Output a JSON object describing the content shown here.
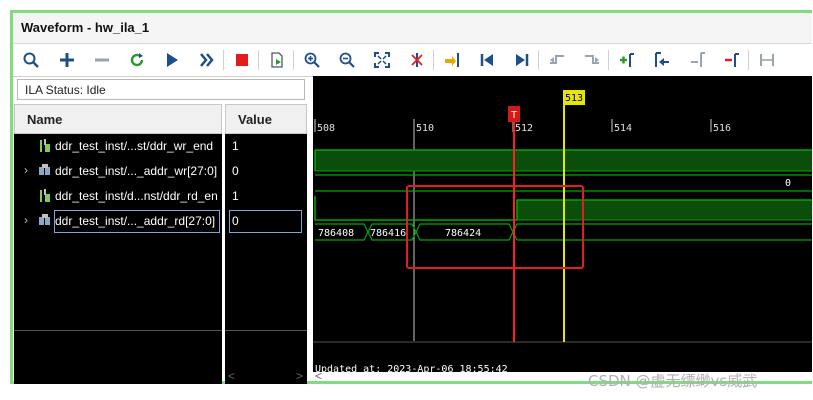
{
  "window": {
    "title": "Waveform - hw_ila_1"
  },
  "toolbar": {
    "icons": [
      "search-icon",
      "plus-icon",
      "minus-icon",
      "refresh-icon",
      "play-icon",
      "fast-forward-icon",
      "stop-icon",
      "export-icon",
      "zoom-in-icon",
      "zoom-out-icon",
      "zoom-fit-icon",
      "cursor-icon",
      "go-to-cursor-icon",
      "first-marker-icon",
      "last-marker-icon",
      "add-marker-icon",
      "remove-marker-icon",
      "prev-transition-icon",
      "next-transition-icon",
      "add-marker-icon",
      "prev-marker-icon",
      "next-marker-icon",
      "swap-cursor-icon"
    ]
  },
  "status": {
    "text": "ILA Status: Idle"
  },
  "columns": {
    "name": "Name",
    "value": "Value"
  },
  "signals": [
    {
      "name": "ddr_test_inst/...st/ddr_wr_end",
      "value": "1",
      "expandable": false,
      "icon": "bit-signal-icon"
    },
    {
      "name": "ddr_test_inst/..._addr_wr[27:0]",
      "value": "0",
      "expandable": true,
      "icon": "bus-signal-icon"
    },
    {
      "name": "ddr_test_inst/d...nst/ddr_rd_en",
      "value": "1",
      "expandable": false,
      "icon": "bit-signal-icon"
    },
    {
      "name": "ddr_test_inst/..._addr_rd[27:0]",
      "value": "0",
      "expandable": true,
      "icon": "bus-signal-icon"
    }
  ],
  "timeline": {
    "ticks": [
      "508",
      "510",
      "512",
      "514",
      "516"
    ],
    "cursor_label": "513",
    "marker_label": "T",
    "bus_wr_value": "0",
    "bus_rd_values": [
      "786408",
      "786416",
      "786424"
    ],
    "updated": "Updated at: 2023-Apr-06 18:55:42"
  },
  "scroll": {
    "left": "<",
    "right": ">",
    "wave_left": "<"
  },
  "watermark": "CSDN @虚无缥缈vs威武",
  "colors": {
    "wave_green": "#00a800",
    "wave_fill": "#0b4d0b",
    "cursor_yellow": "#e6e600",
    "trigger_red": "#ff2020",
    "annotation_red": "#e02020",
    "frame_green": "#7fdc7f"
  }
}
